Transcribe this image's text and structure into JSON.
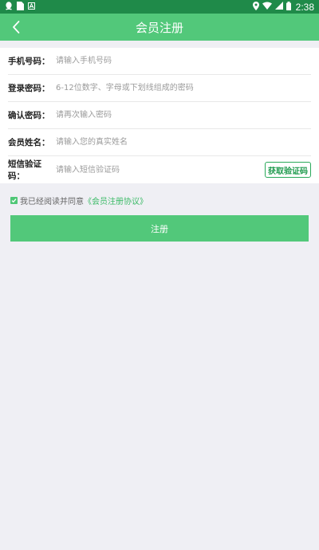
{
  "status_bar": {
    "time": "2:38",
    "left_icons": [
      "qq-icon",
      "sim-icon",
      "notification-a-icon"
    ],
    "right_icons": [
      "location-icon",
      "wifi-icon",
      "cell-signal-icon",
      "battery-icon"
    ]
  },
  "app_bar": {
    "title": "会员注册",
    "back_icon": "chevron-left-icon"
  },
  "form": {
    "phone": {
      "label": "手机号码：",
      "placeholder": "请输入手机号码"
    },
    "password": {
      "label": "登录密码：",
      "placeholder": "6-12位数字、字母或下划线组成的密码"
    },
    "confirm": {
      "label": "确认密码：",
      "placeholder": "请再次输入密码"
    },
    "name": {
      "label": "会员姓名：",
      "placeholder": "请输入您的真实姓名"
    },
    "sms": {
      "label": "短信验证码：",
      "placeholder": "请输入短信验证码",
      "button": "获取验证码"
    }
  },
  "agreement": {
    "text": "我已经阅读并同意",
    "link": "《会员注册协议》",
    "checked": true
  },
  "submit_label": "注册",
  "colors": {
    "status_bar": "#1f8a49",
    "accent": "#52c87a",
    "background": "#efeff4"
  }
}
